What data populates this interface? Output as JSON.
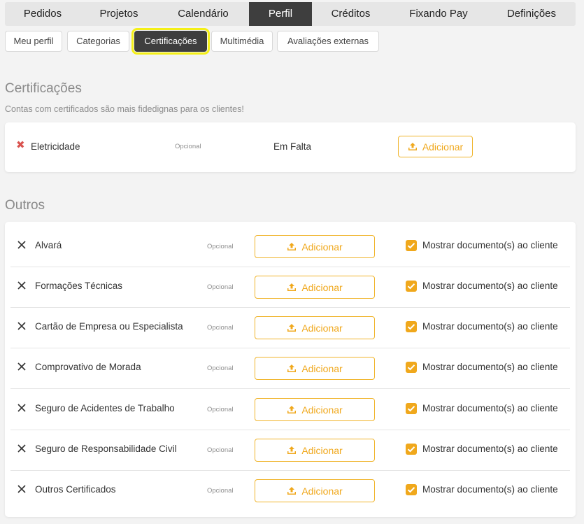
{
  "topnav": {
    "items": [
      {
        "label": "Pedidos"
      },
      {
        "label": "Projetos"
      },
      {
        "label": "Calendário"
      },
      {
        "label": "Perfil"
      },
      {
        "label": "Créditos"
      },
      {
        "label": "Fixando Pay"
      },
      {
        "label": "Definições"
      }
    ],
    "active": "Perfil"
  },
  "subtabs": {
    "items": [
      {
        "label": "Meu perfil"
      },
      {
        "label": "Categorias"
      },
      {
        "label": "Certificações"
      },
      {
        "label": "Multimédia"
      },
      {
        "label": "Avaliações externas"
      }
    ],
    "active": "Certificações"
  },
  "certifications": {
    "title": "Certificações",
    "subtitle": "Contas com certificados são mais fidedignas para os clientes!",
    "items": [
      {
        "name": "Eletricidade",
        "optional": "Opcional",
        "status": "Em Falta",
        "button": "Adicionar",
        "icon": "red-x-icon"
      }
    ]
  },
  "others": {
    "title": "Outros",
    "items": [
      {
        "name": "Alvará",
        "optional": "Opcional",
        "button": "Adicionar",
        "show_label": "Mostrar documento(s) ao cliente",
        "checked": true
      },
      {
        "name": "Formações Técnicas",
        "optional": "Opcional",
        "button": "Adicionar",
        "show_label": "Mostrar documento(s) ao cliente",
        "checked": true
      },
      {
        "name": "Cartão de Empresa ou Especialista",
        "optional": "Opcional",
        "button": "Adicionar",
        "show_label": "Mostrar documento(s) ao cliente",
        "checked": true
      },
      {
        "name": "Comprovativo de Morada",
        "optional": "Opcional",
        "button": "Adicionar",
        "show_label": "Mostrar documento(s) ao cliente",
        "checked": true
      },
      {
        "name": "Seguro de Acidentes de Trabalho",
        "optional": "Opcional",
        "button": "Adicionar",
        "show_label": "Mostrar documento(s) ao cliente",
        "checked": true
      },
      {
        "name": "Seguro de Responsabilidade Civil",
        "optional": "Opcional",
        "button": "Adicionar",
        "show_label": "Mostrar documento(s) ao cliente",
        "checked": true
      },
      {
        "name": "Outros Certificados",
        "optional": "Opcional",
        "button": "Adicionar",
        "show_label": "Mostrar documento(s) ao cliente",
        "checked": true
      }
    ]
  },
  "colors": {
    "accent": "#f0a81c",
    "active_tab": "#3e3e3e",
    "highlight": "#f4ef17",
    "missing": "#d9534f"
  }
}
